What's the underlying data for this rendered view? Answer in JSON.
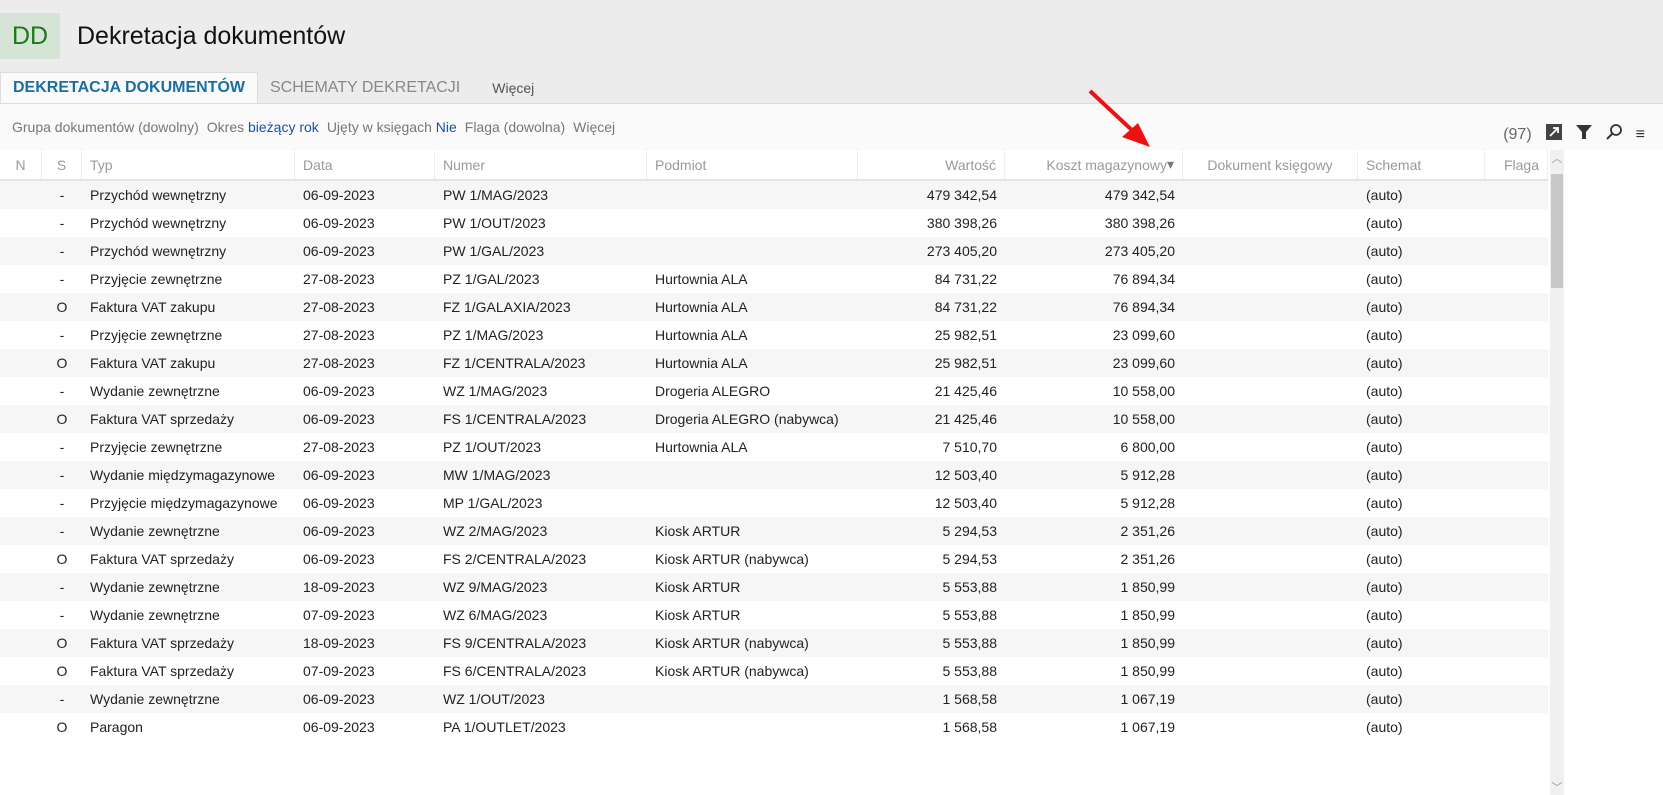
{
  "app": {
    "logo": "DD",
    "title": "Dekretacja dokumentów"
  },
  "tabs": [
    {
      "label": "DEKRETACJA DOKUMENTÓW"
    },
    {
      "label": "SCHEMATY DEKRETACJI"
    },
    {
      "label": "Więcej"
    }
  ],
  "filters": {
    "group": "Grupa dokumentów (dowolny)",
    "period_label": "Okres",
    "period_value": "bieżący rok",
    "booked_label": "Ujęty w księgach",
    "booked_value": "Nie",
    "flag": "Flaga (dowolna)",
    "more": "Więcej"
  },
  "toolbar": {
    "count": "(97)"
  },
  "columns": [
    "N",
    "S",
    "Typ",
    "Data",
    "Numer",
    "Podmiot",
    "Wartość",
    "Koszt magazynowy",
    "Dokument księgowy",
    "Schemat",
    "Flaga"
  ],
  "rows": [
    [
      "",
      "-",
      "Przychód wewnętrzny",
      "06-09-2023",
      "PW 1/MAG/2023",
      "",
      "479 342,54",
      "479 342,54",
      "",
      "(auto)",
      ""
    ],
    [
      "",
      "-",
      "Przychód wewnętrzny",
      "06-09-2023",
      "PW 1/OUT/2023",
      "",
      "380 398,26",
      "380 398,26",
      "",
      "(auto)",
      ""
    ],
    [
      "",
      "-",
      "Przychód wewnętrzny",
      "06-09-2023",
      "PW 1/GAL/2023",
      "",
      "273 405,20",
      "273 405,20",
      "",
      "(auto)",
      ""
    ],
    [
      "",
      "-",
      "Przyjęcie zewnętrzne",
      "27-08-2023",
      "PZ 1/GAL/2023",
      "Hurtownia ALA",
      "84 731,22",
      "76 894,34",
      "",
      "(auto)",
      ""
    ],
    [
      "",
      "O",
      "Faktura VAT zakupu",
      "27-08-2023",
      "FZ 1/GALAXIA/2023",
      "Hurtownia ALA",
      "84 731,22",
      "76 894,34",
      "",
      "(auto)",
      ""
    ],
    [
      "",
      "-",
      "Przyjęcie zewnętrzne",
      "27-08-2023",
      "PZ 1/MAG/2023",
      "Hurtownia ALA",
      "25 982,51",
      "23 099,60",
      "",
      "(auto)",
      ""
    ],
    [
      "",
      "O",
      "Faktura VAT zakupu",
      "27-08-2023",
      "FZ 1/CENTRALA/2023",
      "Hurtownia ALA",
      "25 982,51",
      "23 099,60",
      "",
      "(auto)",
      ""
    ],
    [
      "",
      "-",
      "Wydanie zewnętrzne",
      "06-09-2023",
      "WZ 1/MAG/2023",
      "Drogeria ALEGRO",
      "21 425,46",
      "10 558,00",
      "",
      "(auto)",
      ""
    ],
    [
      "",
      "O",
      "Faktura VAT sprzedaży",
      "06-09-2023",
      "FS 1/CENTRALA/2023",
      "Drogeria ALEGRO (nabywca)",
      "21 425,46",
      "10 558,00",
      "",
      "(auto)",
      ""
    ],
    [
      "",
      "-",
      "Przyjęcie zewnętrzne",
      "27-08-2023",
      "PZ 1/OUT/2023",
      "Hurtownia ALA",
      "7 510,70",
      "6 800,00",
      "",
      "(auto)",
      ""
    ],
    [
      "",
      "-",
      "Wydanie międzymagazynowe",
      "06-09-2023",
      "MW 1/MAG/2023",
      "",
      "12 503,40",
      "5 912,28",
      "",
      "(auto)",
      ""
    ],
    [
      "",
      "-",
      "Przyjęcie międzymagazynowe",
      "06-09-2023",
      "MP 1/GAL/2023",
      "",
      "12 503,40",
      "5 912,28",
      "",
      "(auto)",
      ""
    ],
    [
      "",
      "-",
      "Wydanie zewnętrzne",
      "06-09-2023",
      "WZ 2/MAG/2023",
      "Kiosk ARTUR",
      "5 294,53",
      "2 351,26",
      "",
      "(auto)",
      ""
    ],
    [
      "",
      "O",
      "Faktura VAT sprzedaży",
      "06-09-2023",
      "FS 2/CENTRALA/2023",
      "Kiosk ARTUR (nabywca)",
      "5 294,53",
      "2 351,26",
      "",
      "(auto)",
      ""
    ],
    [
      "",
      "-",
      "Wydanie zewnętrzne",
      "18-09-2023",
      "WZ 9/MAG/2023",
      "Kiosk ARTUR",
      "5 553,88",
      "1 850,99",
      "",
      "(auto)",
      ""
    ],
    [
      "",
      "-",
      "Wydanie zewnętrzne",
      "07-09-2023",
      "WZ 6/MAG/2023",
      "Kiosk ARTUR",
      "5 553,88",
      "1 850,99",
      "",
      "(auto)",
      ""
    ],
    [
      "",
      "O",
      "Faktura VAT sprzedaży",
      "18-09-2023",
      "FS 9/CENTRALA/2023",
      "Kiosk ARTUR (nabywca)",
      "5 553,88",
      "1 850,99",
      "",
      "(auto)",
      ""
    ],
    [
      "",
      "O",
      "Faktura VAT sprzedaży",
      "07-09-2023",
      "FS 6/CENTRALA/2023",
      "Kiosk ARTUR (nabywca)",
      "5 553,88",
      "1 850,99",
      "",
      "(auto)",
      ""
    ],
    [
      "",
      "-",
      "Wydanie zewnętrzne",
      "06-09-2023",
      "WZ 1/OUT/2023",
      "",
      "1 568,58",
      "1 067,19",
      "",
      "(auto)",
      ""
    ],
    [
      "",
      "O",
      "Paragon",
      "06-09-2023",
      "PA 1/OUTLET/2023",
      "",
      "1 568,58",
      "1 067,19",
      "",
      "(auto)",
      ""
    ]
  ],
  "colors": {
    "accent": "#1a6fa0",
    "link": "#1a4fb0",
    "logo": "#1a7a1a",
    "arrow": "#ee1111"
  }
}
